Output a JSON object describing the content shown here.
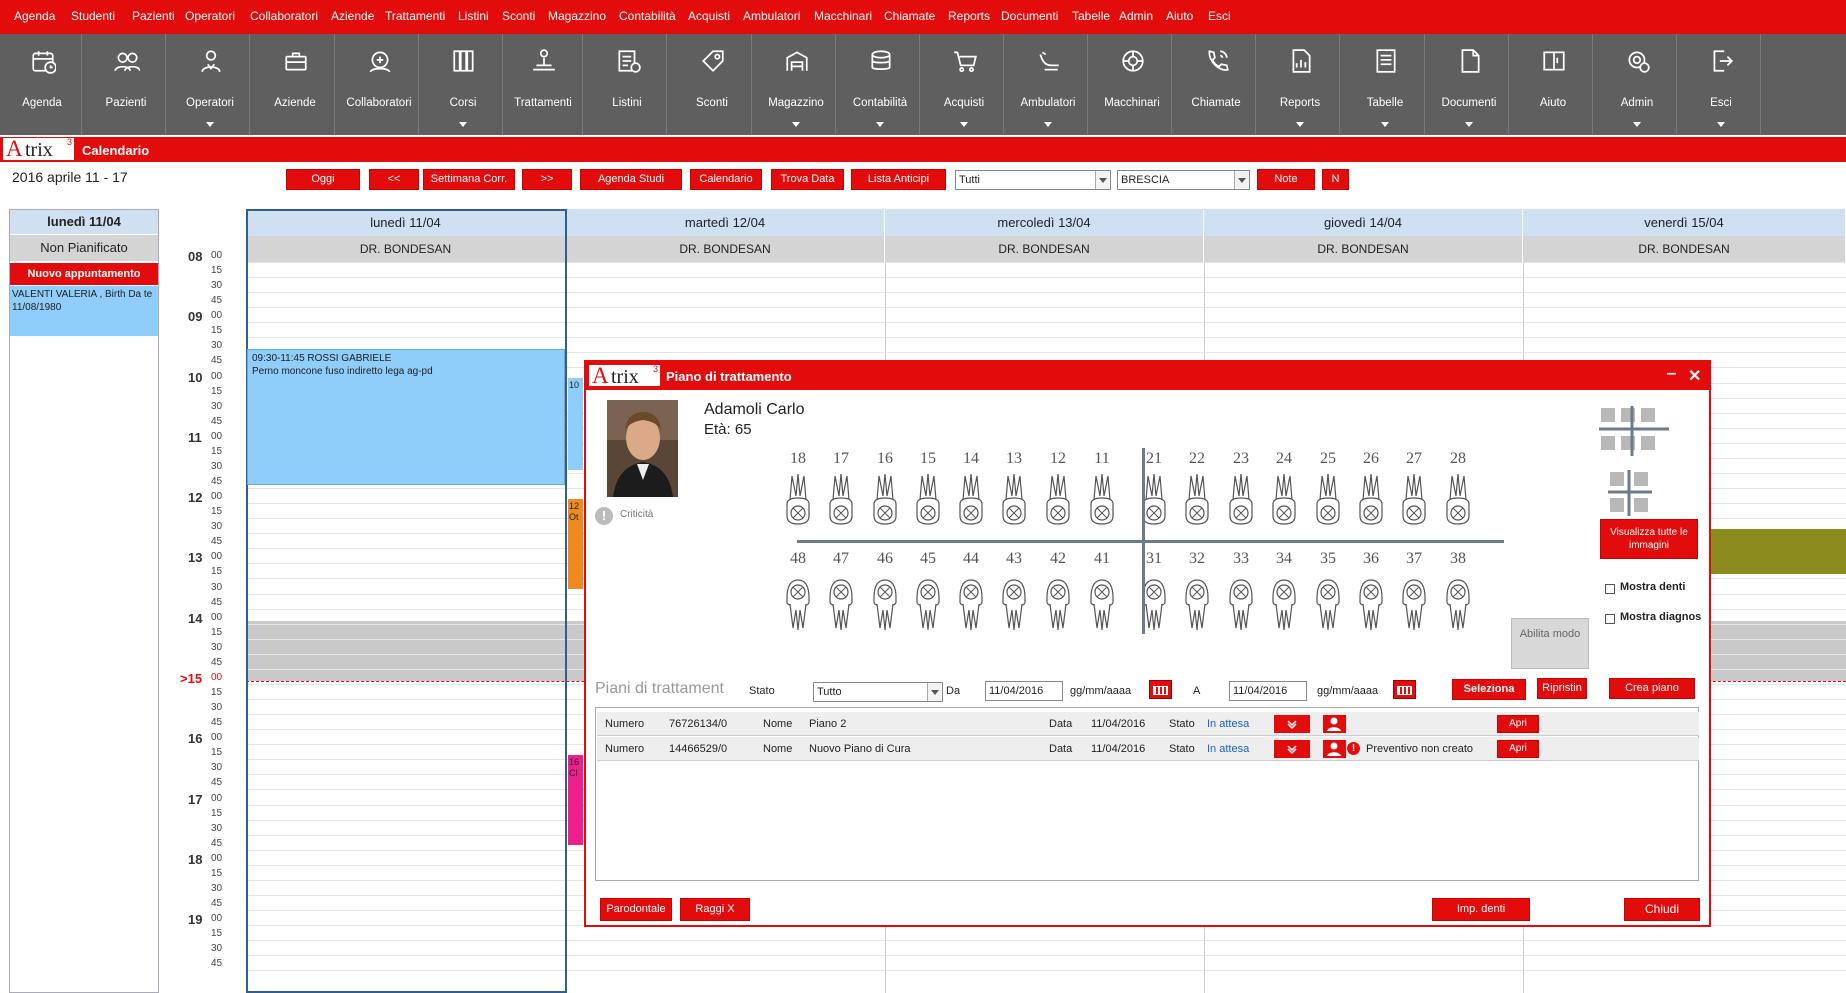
{
  "menu": [
    "Agenda",
    "Studenti",
    "Pazienti",
    "Operatori",
    "Collaboratori",
    "Aziende",
    "Trattamenti",
    "Listini",
    "Sconti",
    "Magazzino",
    "Contabilità",
    "Acquisti",
    "Ambulatori",
    "Macchinari",
    "Chiamate",
    "Reports",
    "Documenti",
    "Tabelle",
    "Admin",
    "Aiuto",
    "Esci"
  ],
  "toolbar": [
    {
      "label": "Agenda",
      "icon": "calendar-clock-icon",
      "caret": false
    },
    {
      "label": "Pazienti",
      "icon": "people-icon",
      "caret": false
    },
    {
      "label": "Operatori",
      "icon": "doctor-icon",
      "caret": true
    },
    {
      "label": "Aziende",
      "icon": "briefcase-icon",
      "caret": false
    },
    {
      "label": "Collaboratori",
      "icon": "collaborator-icon",
      "caret": false
    },
    {
      "label": "Corsi",
      "icon": "books-icon",
      "caret": true
    },
    {
      "label": "Trattamenti",
      "icon": "treatment-icon",
      "caret": false
    },
    {
      "label": "Listini",
      "icon": "pricelist-icon",
      "caret": false
    },
    {
      "label": "Sconti",
      "icon": "discount-tag-icon",
      "caret": false
    },
    {
      "label": "Magazzino",
      "icon": "warehouse-icon",
      "caret": true
    },
    {
      "label": "Contabilità",
      "icon": "coins-icon",
      "caret": true
    },
    {
      "label": "Acquisti",
      "icon": "cart-icon",
      "caret": true
    },
    {
      "label": "Ambulatori",
      "icon": "dental-chair-icon",
      "caret": true
    },
    {
      "label": "Macchinari",
      "icon": "machine-icon",
      "caret": false
    },
    {
      "label": "Chiamate",
      "icon": "phone-icon",
      "caret": false
    },
    {
      "label": "Reports",
      "icon": "report-icon",
      "caret": true
    },
    {
      "label": "Tabelle",
      "icon": "table-icon",
      "caret": true
    },
    {
      "label": "Documenti",
      "icon": "document-icon",
      "caret": true
    },
    {
      "label": "Aiuto",
      "icon": "help-book-icon",
      "caret": false
    },
    {
      "label": "Admin",
      "icon": "admin-gear-icon",
      "caret": true
    },
    {
      "label": "Esci",
      "icon": "exit-icon",
      "caret": true
    }
  ],
  "app": {
    "logo_a": "A",
    "logo_rest": "trix",
    "logo_sup": "3",
    "title": "Calendario",
    "week": "2016 aprile 11 - 17"
  },
  "controls": {
    "oggi": "Oggi",
    "prev": "<<",
    "current_week": "Settimana Corr.",
    "next": ">>",
    "agenda_studi": "Agenda Studi",
    "calendario": "Calendario",
    "trova_data": "Trova Data",
    "lista_anticipi": "Lista Anticipi",
    "filter1": "Tutti",
    "filter2": "BRESCIA",
    "note": "Note",
    "n": "N"
  },
  "left": {
    "day": "lunedì 11/04",
    "non_pianificato": "Non Pianificato",
    "nuovo": "Nuovo appuntamento",
    "entry": "VALENTI VALERIA , Birth Da te 11/08/1980"
  },
  "hours": [
    "08",
    "09",
    "10",
    "11",
    "12",
    "13",
    "14",
    "15",
    "16",
    "17",
    "18",
    "19"
  ],
  "minutes": [
    "00",
    "15",
    "30",
    "45"
  ],
  "current_hour_marker": ">15",
  "days": [
    {
      "name": "lunedì 11/04",
      "doctor": "DR. BONDESAN"
    },
    {
      "name": "martedì 12/04",
      "doctor": "DR. BONDESAN"
    },
    {
      "name": "mercoledì 13/04",
      "doctor": "DR. BONDESAN"
    },
    {
      "name": "giovedì 14/04",
      "doctor": "DR. BONDESAN"
    },
    {
      "name": "venerdì 15/04",
      "doctor": "DR. BONDESAN"
    }
  ],
  "appointment": {
    "time": "09:30-11:45 ROSSI GABRIELE",
    "desc": "Perno moncone fuso indiretto lega ag-pd"
  },
  "peek": {
    "a": "10",
    "b": "12",
    "b2": "Ot",
    "c": "16",
    "c2": "Cl"
  },
  "dialog": {
    "title": "Piano di trattamento",
    "minimize": "‒",
    "close": "✕",
    "patient_name": "Adamoli Carlo",
    "patient_age": "Età: 65",
    "criticita": "Criticità",
    "upper_teeth": [
      "18",
      "17",
      "16",
      "15",
      "14",
      "13",
      "12",
      "11",
      "21",
      "22",
      "23",
      "24",
      "25",
      "26",
      "27",
      "28"
    ],
    "lower_teeth": [
      "48",
      "47",
      "46",
      "45",
      "44",
      "43",
      "42",
      "41",
      "31",
      "32",
      "33",
      "34",
      "35",
      "36",
      "37",
      "38"
    ],
    "view_all": "Visualizza tutte le immagini",
    "show_teeth": "Mostra denti",
    "show_diag": "Mostra diagnos",
    "enable_mode": "Abilita modo",
    "plans_title": "Piani di trattament",
    "stato_label": "Stato",
    "stato_value": "Tutto",
    "da_label": "Da",
    "date_from": "11/04/2016",
    "date_format": "gg/mm/aaaa",
    "a_label": "A",
    "date_to": "11/04/2016",
    "seleziona": "Seleziona",
    "ripristina": "Ripristin",
    "crea": "Crea piano",
    "plans": [
      {
        "numero_label": "Numero",
        "numero": "76726134/0",
        "nome_label": "Nome",
        "nome": "Piano 2",
        "data_label": "Data",
        "data": "11/04/2016",
        "stato_label": "Stato",
        "stato": "In attesa",
        "warning": "",
        "apri": "Apri"
      },
      {
        "numero_label": "Numero",
        "numero": "14466529/0",
        "nome_label": "Nome",
        "nome": "Nuovo Piano di Cura",
        "data_label": "Data",
        "data": "11/04/2016",
        "stato_label": "Stato",
        "stato": "In attesa",
        "warning": "Preventivo non creato",
        "apri": "Apri"
      }
    ],
    "parodontale": "Parodontale",
    "raggi": "Raggi X",
    "imp_denti": "Imp. denti",
    "chiudi": "Chiudi"
  },
  "colors": {
    "brand": "#e30c0c",
    "toolbar": "#5f5f5f",
    "appointment": "#8fcdfa",
    "link": "#1565c0"
  }
}
